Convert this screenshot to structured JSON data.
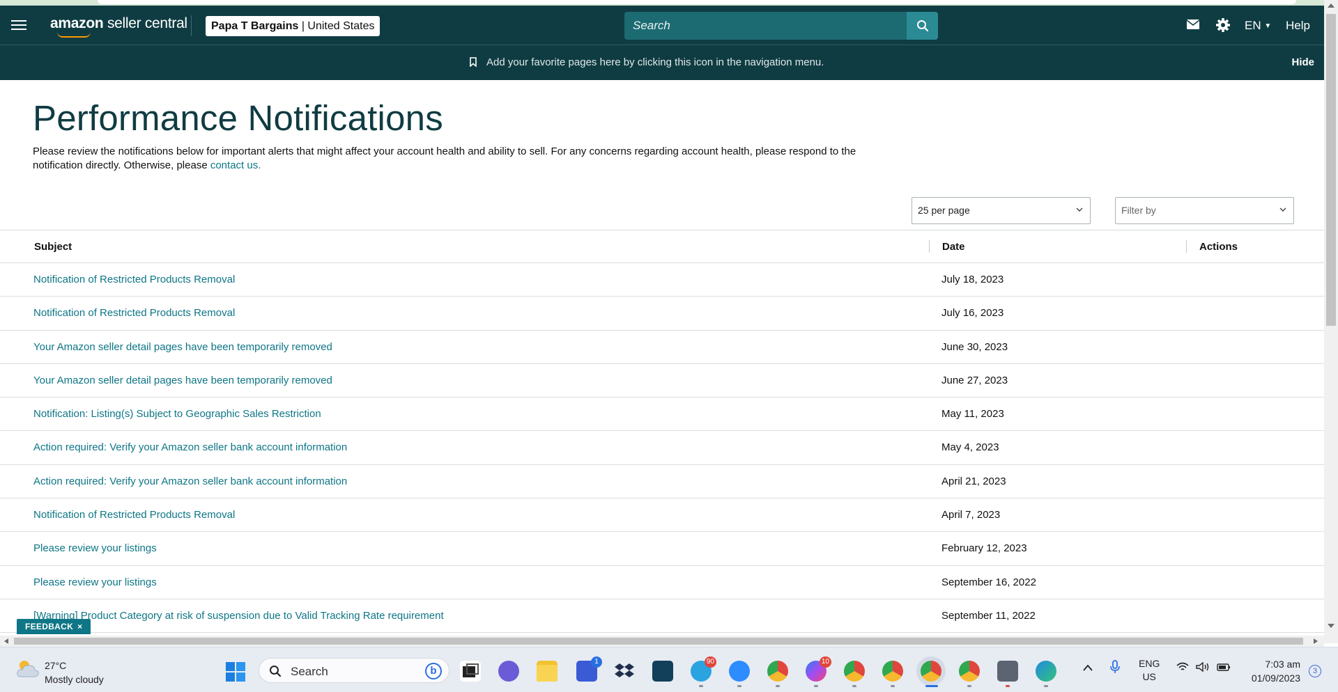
{
  "header": {
    "logo_brand": "amazon",
    "logo_product": "seller central",
    "store_name": "Papa T Bargains",
    "store_sep": " | ",
    "store_region": "United States",
    "search_placeholder": "Search",
    "lang": "EN",
    "help": "Help"
  },
  "banner": {
    "message": "Add your favorite pages here by clicking this icon in the navigation menu.",
    "hide": "Hide"
  },
  "page": {
    "title": "Performance Notifications",
    "intro_text": "Please review the notifications below for important alerts that might affect your account health and ability to sell. For any concerns regarding account health, please respond to the notification directly. Otherwise, please ",
    "intro_link": "contact us."
  },
  "controls": {
    "per_page": "25 per page",
    "filter": "Filter by"
  },
  "table": {
    "headers": {
      "subject": "Subject",
      "date": "Date",
      "actions": "Actions"
    },
    "rows": [
      {
        "subject": "Notification of Restricted Products Removal",
        "date": "July 18, 2023"
      },
      {
        "subject": "Notification of Restricted Products Removal",
        "date": "July 16, 2023"
      },
      {
        "subject": "Your Amazon seller detail pages have been temporarily removed",
        "date": "June 30, 2023"
      },
      {
        "subject": "Your Amazon seller detail pages have been temporarily removed",
        "date": "June 27, 2023"
      },
      {
        "subject": "Notification: Listing(s) Subject to Geographic Sales Restriction",
        "date": "May 11, 2023"
      },
      {
        "subject": "Action required: Verify your Amazon seller bank account information",
        "date": "May 4, 2023"
      },
      {
        "subject": "Action required: Verify your Amazon seller bank account information",
        "date": "April 21, 2023"
      },
      {
        "subject": "Notification of Restricted Products Removal",
        "date": "April 7, 2023"
      },
      {
        "subject": "Please review your listings",
        "date": "February 12, 2023"
      },
      {
        "subject": "Please review your listings",
        "date": "September 16, 2022"
      },
      {
        "subject": "[Warning] Product Category at risk of suspension due to Valid Tracking Rate requirement",
        "date": "September 11, 2022"
      }
    ]
  },
  "feedback": {
    "label": "FEEDBACK",
    "close": "×"
  },
  "taskbar": {
    "temp": "27°C",
    "weather": "Mostly cloudy",
    "search": "Search",
    "badges": {
      "telegram": "90",
      "store": "1",
      "messenger": "10"
    },
    "lang_top": "ENG",
    "lang_bottom": "US",
    "time": "7:03 am",
    "date": "01/09/2023",
    "notifications": "3"
  },
  "colors": {
    "header_bg": "#0f3c42",
    "link": "#0e7686",
    "accent": "#ff9900"
  }
}
